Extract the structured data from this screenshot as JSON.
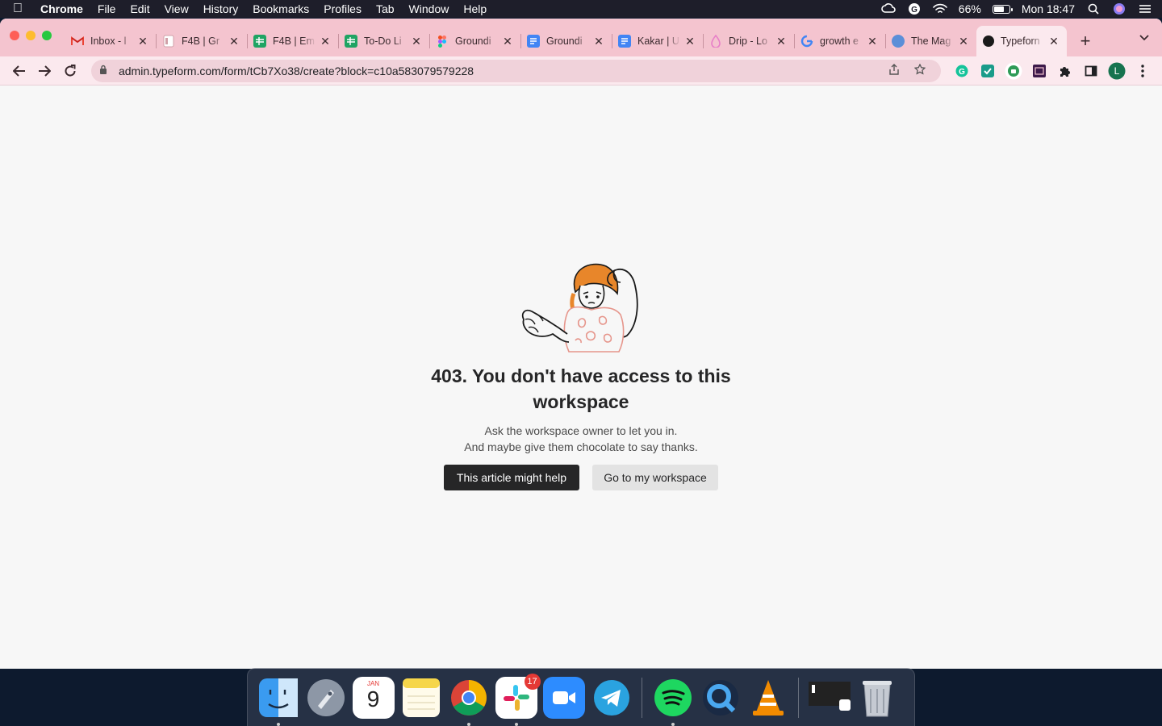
{
  "menubar": {
    "app_name": "Chrome",
    "items": [
      "File",
      "Edit",
      "View",
      "History",
      "Bookmarks",
      "Profiles",
      "Tab",
      "Window",
      "Help"
    ],
    "battery": "66%",
    "clock": "Mon 18:47"
  },
  "tabs": [
    {
      "title": "Inbox - l",
      "icon": "gmail-icon",
      "color": "#ea4335"
    },
    {
      "title": "F4B | Gr",
      "icon": "doc-icon",
      "color": "#d0a0a8"
    },
    {
      "title": "F4B | Em",
      "icon": "sheets-icon",
      "color": "#1fa463"
    },
    {
      "title": "To-Do Li",
      "icon": "sheets-icon",
      "color": "#1fa463"
    },
    {
      "title": "Groundi",
      "icon": "figma-icon",
      "color": "#a259ff"
    },
    {
      "title": "Groundi",
      "icon": "docs-icon",
      "color": "#4285f4"
    },
    {
      "title": "Kakar | U",
      "icon": "docs-icon",
      "color": "#4285f4"
    },
    {
      "title": "Drip - Lo",
      "icon": "drip-icon",
      "color": "#e77fc8"
    },
    {
      "title": "growth e",
      "icon": "google-icon",
      "color": "#4285f4"
    },
    {
      "title": "The Mag",
      "icon": "mag-icon",
      "color": "#5b8fd8"
    },
    {
      "title": "Typeforn",
      "icon": "typeform-icon",
      "color": "#1a1a1a",
      "active": true
    }
  ],
  "address_bar": {
    "url": "admin.typeform.com/form/tCb7Xo38/create?block=c10a583079579228"
  },
  "profile_initial": "L",
  "error": {
    "heading": "403. You don't have access to this workspace",
    "line1": "Ask the workspace owner to let you in.",
    "line2": "And maybe give them chocolate to say thanks.",
    "primary_button": "This article might help",
    "secondary_button": "Go to my workspace"
  },
  "dock": {
    "calendar_month": "JAN",
    "calendar_day": "9",
    "slack_badge": "17"
  }
}
